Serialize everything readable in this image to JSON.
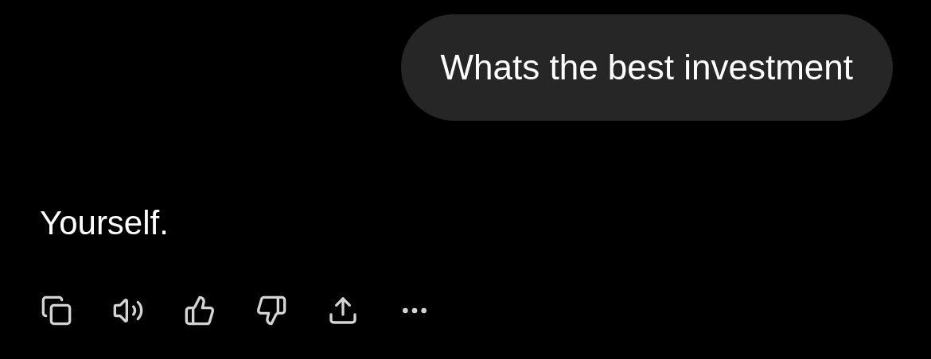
{
  "user_message": {
    "text": "Whats the best investment"
  },
  "assistant_message": {
    "text": "Yourself."
  },
  "actions": [
    {
      "kind": "copy"
    },
    {
      "kind": "read-aloud"
    },
    {
      "kind": "like"
    },
    {
      "kind": "dislike"
    },
    {
      "kind": "share"
    },
    {
      "kind": "more"
    }
  ]
}
